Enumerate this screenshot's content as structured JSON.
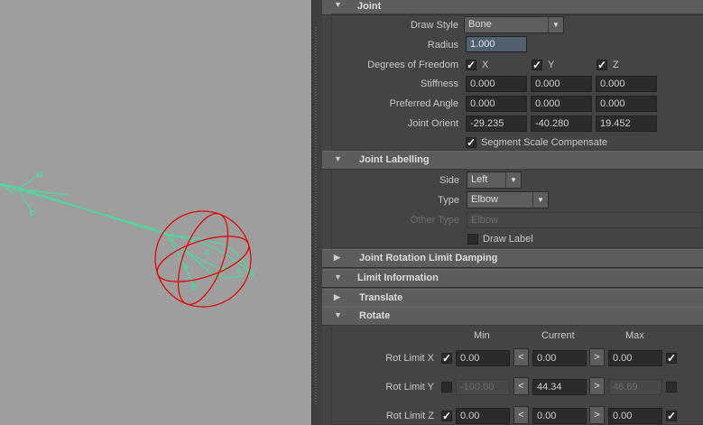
{
  "joint": {
    "header": "Joint",
    "draw_style_label": "Draw Style",
    "draw_style_value": "Bone",
    "radius_label": "Radius",
    "radius_value": "1.000",
    "dof_label": "Degrees of Freedom",
    "dof": [
      {
        "axis": "X",
        "checked": true
      },
      {
        "axis": "Y",
        "checked": true
      },
      {
        "axis": "Z",
        "checked": true
      }
    ],
    "stiffness_label": "Stiffness",
    "stiffness": [
      "0.000",
      "0.000",
      "0.000"
    ],
    "preferred_angle_label": "Preferred Angle",
    "preferred_angle": [
      "0.000",
      "0.000",
      "0.000"
    ],
    "joint_orient_label": "Joint Orient",
    "joint_orient": [
      "-29.235",
      "-40.280",
      "19.452"
    ],
    "segment_scale_label": "Segment Scale Compensate",
    "segment_scale_checked": true
  },
  "joint_labelling": {
    "header": "Joint Labelling",
    "side_label": "Side",
    "side_value": "Left",
    "type_label": "Type",
    "type_value": "Elbow",
    "other_type_label": "Other Type",
    "other_type_value": "Elbow",
    "draw_label_label": "Draw Label",
    "draw_label_checked": false
  },
  "collapsed_sections": {
    "rotation_limit_damping": "Joint Rotation Limit Damping",
    "limit_information": "Limit Information",
    "translate": "Translate"
  },
  "rotate": {
    "header": "Rotate",
    "col_min": "Min",
    "col_current": "Current",
    "col_max": "Max",
    "rows": [
      {
        "label": "Rot Limit X",
        "min_enabled": true,
        "min": "0.00",
        "current": "0.00",
        "max": "0.00",
        "max_enabled": true
      },
      {
        "label": "Rot Limit Y",
        "min_enabled": false,
        "min": "-100.00",
        "current": "44.34",
        "max": "46.69",
        "max_enabled": false
      },
      {
        "label": "Rot Limit Z",
        "min_enabled": true,
        "min": "0.00",
        "current": "0.00",
        "max": "0.00",
        "max_enabled": true
      }
    ]
  },
  "icons": {
    "expanded": "triangle-down-icon",
    "collapsed": "triangle-right-icon",
    "check": "checkmark-icon",
    "step_left": "arrow-left-icon",
    "step_right": "arrow-right-icon"
  },
  "colors": {
    "viewport_bg": "#9e9e9e",
    "joint_color": "#40e0a0",
    "rotate_manip": "#e00000",
    "panel_bg": "#444444",
    "header_bg": "#5d5d5d",
    "field_bg": "#2b2b2b"
  }
}
